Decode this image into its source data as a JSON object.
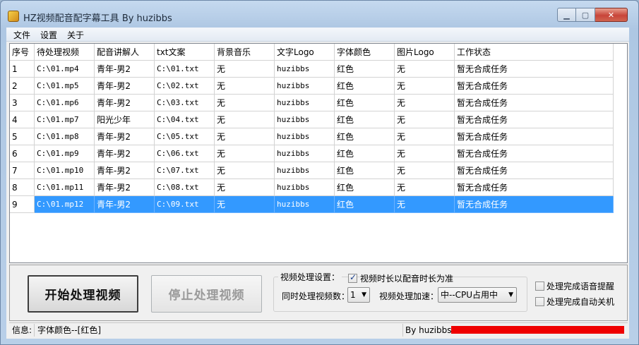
{
  "window": {
    "title": "HZ视频配音配字幕工具 By huzibbs"
  },
  "menu": {
    "items": [
      "文件",
      "设置",
      "关于"
    ]
  },
  "table": {
    "columns": [
      "序号",
      "待处理视频",
      "配音讲解人",
      "txt文案",
      "背景音乐",
      "文字Logo",
      "字体颜色",
      "图片Logo",
      "工作状态"
    ],
    "rows": [
      [
        "1",
        "C:\\01.mp4",
        "青年-男2",
        "C:\\01.txt",
        "无",
        "huzibbs",
        "红色",
        "无",
        "暂无合成任务"
      ],
      [
        "2",
        "C:\\01.mp5",
        "青年-男2",
        "C:\\02.txt",
        "无",
        "huzibbs",
        "红色",
        "无",
        "暂无合成任务"
      ],
      [
        "3",
        "C:\\01.mp6",
        "青年-男2",
        "C:\\03.txt",
        "无",
        "huzibbs",
        "红色",
        "无",
        "暂无合成任务"
      ],
      [
        "4",
        "C:\\01.mp7",
        "阳光少年",
        "C:\\04.txt",
        "无",
        "huzibbs",
        "红色",
        "无",
        "暂无合成任务"
      ],
      [
        "5",
        "C:\\01.mp8",
        "青年-男2",
        "C:\\05.txt",
        "无",
        "huzibbs",
        "红色",
        "无",
        "暂无合成任务"
      ],
      [
        "6",
        "C:\\01.mp9",
        "青年-男2",
        "C:\\06.txt",
        "无",
        "huzibbs",
        "红色",
        "无",
        "暂无合成任务"
      ],
      [
        "7",
        "C:\\01.mp10",
        "青年-男2",
        "C:\\07.txt",
        "无",
        "huzibbs",
        "红色",
        "无",
        "暂无合成任务"
      ],
      [
        "8",
        "C:\\01.mp11",
        "青年-男2",
        "C:\\08.txt",
        "无",
        "huzibbs",
        "红色",
        "无",
        "暂无合成任务"
      ],
      [
        "9",
        "C:\\01.mp12",
        "青年-男2",
        "C:\\09.txt",
        "无",
        "huzibbs",
        "红色",
        "无",
        "暂无合成任务"
      ]
    ],
    "selected_row": 9
  },
  "buttons": {
    "start": "开始处理视频",
    "stop": "停止处理视频"
  },
  "settings": {
    "group_label": "视频处理设置：",
    "duration_check_label": "视频时长以配音时长为准",
    "duration_checked": true,
    "concurrent_label": "同时处理视频数：",
    "concurrent_value": "1",
    "accel_label": "视频处理加速：",
    "accel_value": "中--CPU占用中"
  },
  "options": {
    "voice_alert_label": "处理完成语音提醒",
    "voice_alert_checked": false,
    "auto_shutdown_label": "处理完成自动关机",
    "auto_shutdown_checked": false
  },
  "status": {
    "info_label": "信息:",
    "info_text": "字体颜色--[红色]",
    "author": "By huzibbs"
  },
  "colors": {
    "selection": "#3399ff",
    "redaction": "#ef0000"
  }
}
